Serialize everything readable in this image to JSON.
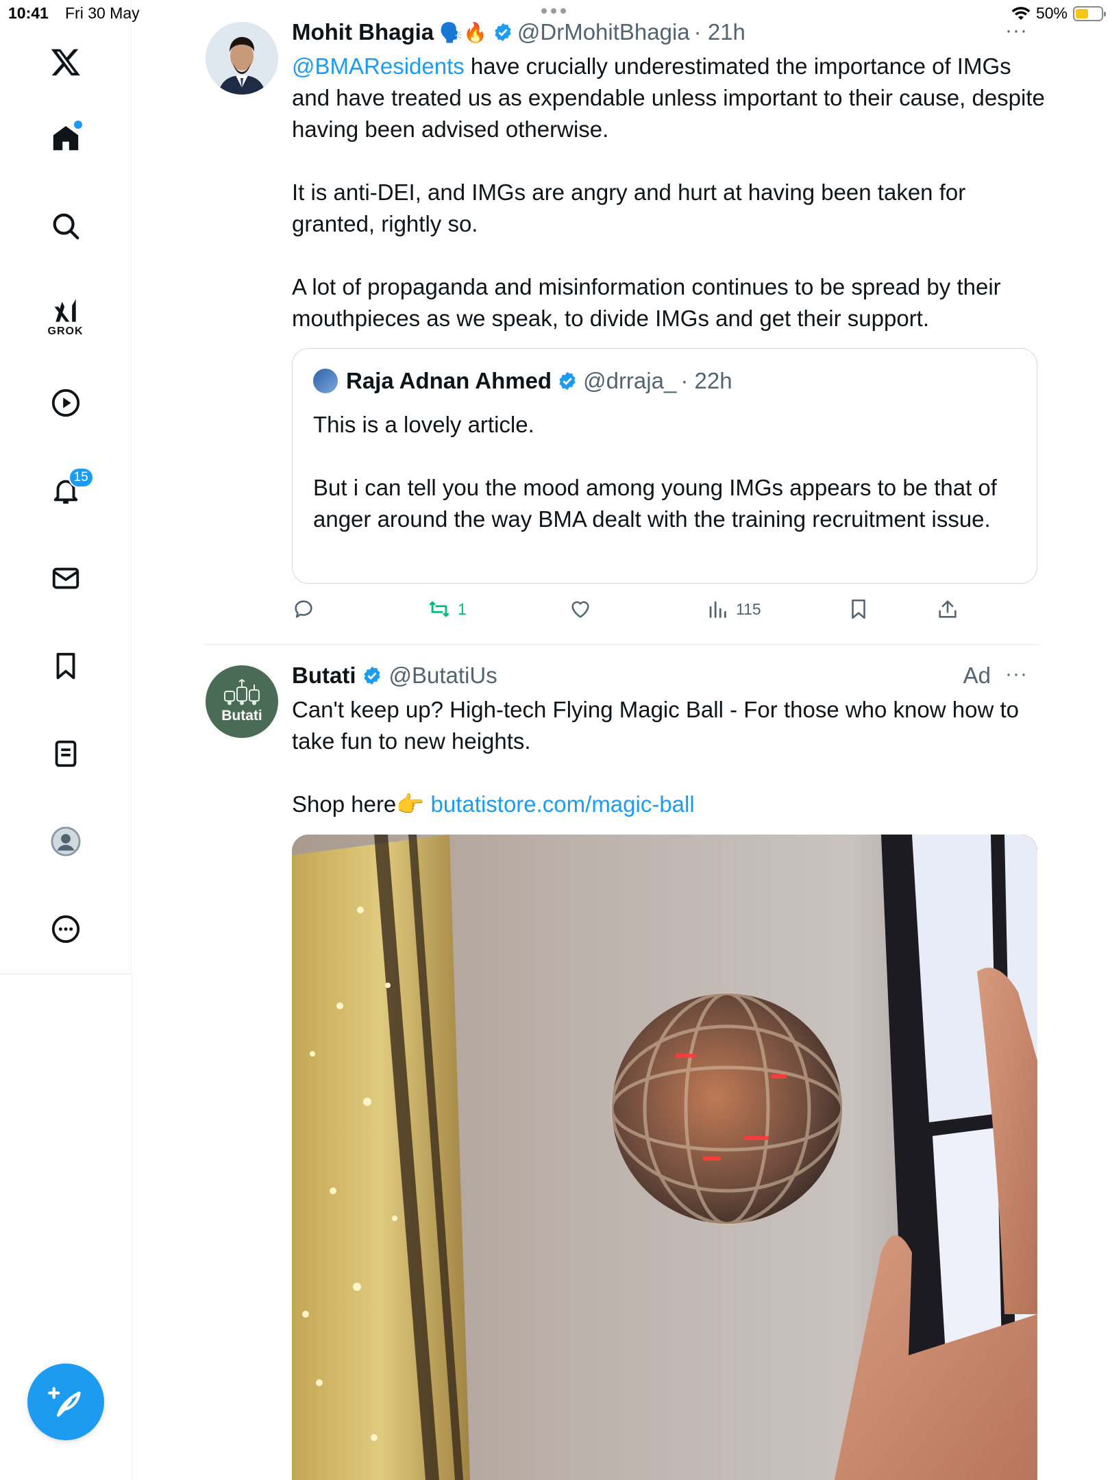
{
  "status_bar": {
    "time": "10:41",
    "date": "Fri 30 May",
    "battery": "50%",
    "battery_level": 0.5
  },
  "sidebar": {
    "items": [
      {
        "name": "x-logo",
        "label": ""
      },
      {
        "name": "home",
        "label": ""
      },
      {
        "name": "search",
        "label": ""
      },
      {
        "name": "grok",
        "label": "GROK"
      },
      {
        "name": "video",
        "label": ""
      },
      {
        "name": "notifications",
        "label": "",
        "badge": "15"
      },
      {
        "name": "messages",
        "label": ""
      },
      {
        "name": "bookmarks",
        "label": ""
      },
      {
        "name": "lists",
        "label": ""
      },
      {
        "name": "profile",
        "label": ""
      },
      {
        "name": "more",
        "label": ""
      }
    ]
  },
  "posts": [
    {
      "name": "Mohit Bhagia",
      "emoji": "🗣️🔥",
      "handle": "@DrMohitBhagia",
      "time": "· 21h",
      "mention": "@BMAResidents",
      "text_after_mention": " have crucially underestimated the importance of IMGs and have treated us as expendable unless important to their cause, despite having been advised otherwise.",
      "paragraph_2": "It is anti-DEI, and IMGs are angry and hurt at having been taken for granted, rightly so.",
      "paragraph_3": "A lot of propaganda and misinformation continues to be spread by their mouthpieces as we speak, to divide IMGs and get their support.",
      "quote": {
        "name": "Raja Adnan Ahmed",
        "handle": "@drraja_",
        "time": "· 22h",
        "text": "This is a lovely article.\n\nBut i can tell you the mood among young IMGs appears to be that of anger around the way BMA dealt with the training recruitment issue."
      },
      "actions": {
        "reposts": "1",
        "views": "115"
      }
    },
    {
      "name": "Butati",
      "avatar_text": "Butati",
      "handle": "@ButatiUs",
      "ad_label": "Ad",
      "text": "Can't keep up? High-tech Flying Magic Ball - For those who know how to take fun to new heights.",
      "shop_text": "Shop here👉 ",
      "shop_link": "butatistore.com/magic-ball"
    }
  ],
  "colors": {
    "accent": "#1d9bf0",
    "repost_green": "#00ba7c",
    "secondary_text": "#536471",
    "butati_bg": "#4a6b55"
  }
}
